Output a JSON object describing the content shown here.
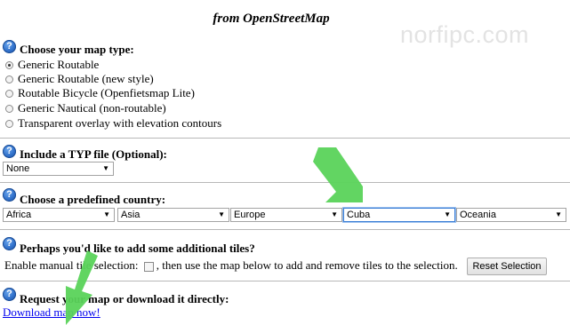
{
  "page": {
    "title": "from OpenStreetMap",
    "watermark": "norfipc.com"
  },
  "sections": {
    "map_type": {
      "heading": "Choose your map type:",
      "options": [
        {
          "label": "Generic Routable",
          "selected": true
        },
        {
          "label": "Generic Routable (new style)",
          "selected": false
        },
        {
          "label": "Routable Bicycle (Openfietsmap Lite)",
          "selected": false
        },
        {
          "label": "Generic Nautical (non-routable)",
          "selected": false
        },
        {
          "label": "Transparent overlay with elevation contours",
          "selected": false
        }
      ]
    },
    "typ": {
      "heading": "Include a TYP file (Optional):",
      "value": "None"
    },
    "country": {
      "heading": "Choose a predefined country:",
      "selects": [
        "Africa",
        "Asia",
        "Europe",
        "Cuba",
        "Oceania"
      ]
    },
    "tiles": {
      "heading": "Perhaps you'd like to add some additional tiles?",
      "text_before": "Enable manual tile selection:",
      "text_after": ", then use the map below to add and remove tiles to the selection.",
      "button": "Reset Selection"
    },
    "request": {
      "heading": "Request your map or download it directly:",
      "link": "Download map now!"
    }
  },
  "icons": {
    "help": "question-mark-icon",
    "arrow": "green-arrow-icon"
  },
  "colors": {
    "help_icon": "#2f6fc9",
    "arrow": "#5ad35a",
    "link": "#0000ee",
    "watermark": "#e3e3e3"
  }
}
